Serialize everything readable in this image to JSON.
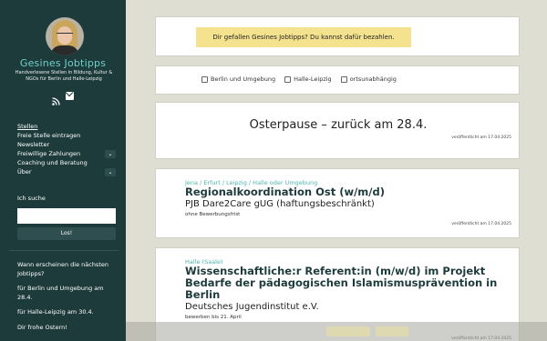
{
  "sidebar": {
    "site_title": "Gesines Jobtipps",
    "tagline": "Handverlesene Stellen in Bildung, Kultur & NGOs für Berlin und Halle-Leipzig",
    "nav": [
      {
        "label": "Stellen",
        "current": true,
        "has_submenu": false
      },
      {
        "label": "Freie Stelle eintragen",
        "current": false,
        "has_submenu": false
      },
      {
        "label": "Newsletter",
        "current": false,
        "has_submenu": false
      },
      {
        "label": "Freiwillige Zahlungen",
        "current": false,
        "has_submenu": true
      },
      {
        "label": "Coaching und Beratung",
        "current": false,
        "has_submenu": false
      },
      {
        "label": "Über",
        "current": false,
        "has_submenu": true
      }
    ],
    "search_label": "Ich suche",
    "search_value": "",
    "search_button": "Los!",
    "info": [
      "Wann erscheinen die nächsten Jobtipps?",
      "für Berlin und Umgebung am 28.4.",
      "für Halle-Leipzig am 30.4.",
      "Dir frohe Ostern!"
    ]
  },
  "support_banner": "Dir gefallen Gesines Jobtipps? Du kannst dafür bezahlen.",
  "filters": [
    "Berlin und Umgebung",
    "Halle-Leipzig",
    "ortsunabhängig"
  ],
  "announcement": {
    "title": "Osterpause – zurück am 28.4.",
    "posted": "veröffentlicht am 17.04.2025"
  },
  "jobs": [
    {
      "locations": "Jena / Erfurt / Leipzig / Halle oder Umgebung",
      "title": "Regionalkoordination Ost (w/m/d)",
      "employer": "PJB Dare2Care gUG (haftungsbeschränkt)",
      "deadline": "ohne Bewerbungsfrist",
      "posted": "veröffentlicht am 17.04.2025"
    },
    {
      "locations": "Halle (Saale)",
      "title": "Wissenschaftliche:r Referent:in (m/w/d) im Projekt Bedarfe der pädagogischen Islamismusprävention in Berlin",
      "employer": "Deutsches Jugendinstitut e.V.",
      "deadline": "bewerben bis 21. April",
      "posted": "veröffentlicht am 17.04.2025"
    }
  ],
  "colors": {
    "sidebar_bg": "#1e3b3c",
    "accent": "#6fcfcb",
    "banner": "#f5e28f",
    "page_bg": "#deded3"
  }
}
